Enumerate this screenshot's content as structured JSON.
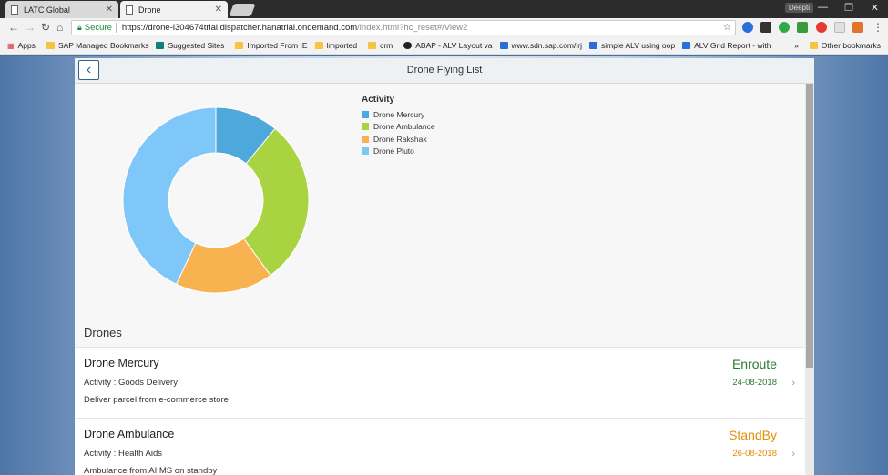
{
  "browser": {
    "tabs": [
      {
        "label": "LATC Global"
      },
      {
        "label": "Drone"
      }
    ],
    "user_badge": "Deepti",
    "security_label": "Secure",
    "url_host": "https://drone-i304674trial.dispatcher.hanatrial.ondemand.com",
    "url_path": "/index.html?hc_reset#/View2"
  },
  "bookmarks": {
    "items": [
      {
        "label": "Apps",
        "icon": "apps-grid-icon"
      },
      {
        "label": "SAP Managed Bookmarks",
        "icon": "folder-icon"
      },
      {
        "label": "Suggested Sites",
        "icon": "bing-icon"
      },
      {
        "label": "Imported From IE",
        "icon": "folder-icon"
      },
      {
        "label": "Imported",
        "icon": "folder-icon"
      },
      {
        "label": "crm",
        "icon": "folder-icon"
      },
      {
        "label": "ABAP - ALV Layout va",
        "icon": "globe-icon"
      },
      {
        "label": "www.sdn.sap.com/irj",
        "icon": "sap-icon"
      },
      {
        "label": "simple ALV using oop",
        "icon": "sap-icon"
      },
      {
        "label": "ALV Grid Report - with",
        "icon": "sap-icon"
      }
    ],
    "overflow": "»",
    "other": "Other bookmarks"
  },
  "app": {
    "title": "Drone Flying List",
    "back_icon": "chevron-left-icon",
    "section_title": "Drones"
  },
  "chart_data": {
    "type": "pie",
    "legend_title": "Activity",
    "categories": [
      "Drone Mercury",
      "Drone Ambulance",
      "Drone Rakshak",
      "Drone Pluto"
    ],
    "values": [
      11,
      29,
      17,
      43
    ],
    "colors": [
      "#4fa8db",
      "#a9d341",
      "#f8b350",
      "#7ec7f8"
    ],
    "donut": true,
    "legend_position": "right"
  },
  "drones": [
    {
      "name": "Drone Mercury",
      "activity": "Activity : Goods Delivery",
      "description": "Deliver parcel from e-commerce store",
      "status": "Enroute",
      "status_color": "#2b7c2b",
      "date": "24-08-2018"
    },
    {
      "name": "Drone Ambulance",
      "activity": "Activity : Health Aids",
      "description": "Ambulance from AIIMS on standby",
      "status": "StandBy",
      "status_color": "#e78c07",
      "date": "26-08-2018"
    }
  ]
}
